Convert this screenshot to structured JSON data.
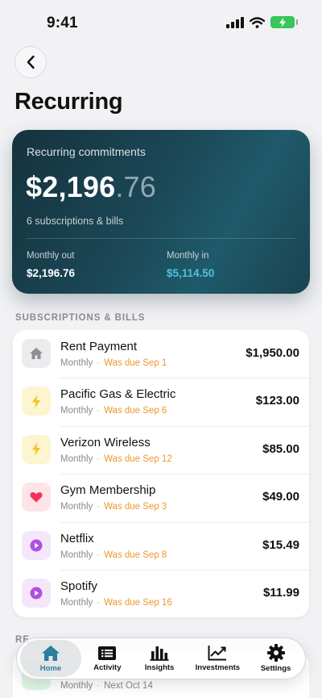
{
  "status": {
    "time": "9:41"
  },
  "page": {
    "title": "Recurring"
  },
  "summary": {
    "label": "Recurring commitments",
    "amount_main": "$2,196",
    "amount_cents": ".76",
    "subtitle": "6 subscriptions & bills",
    "monthly_out_label": "Monthly out",
    "monthly_out_value": "$2,196.76",
    "monthly_in_label": "Monthly in",
    "monthly_in_value": "$5,114.50"
  },
  "section": {
    "label": "SUBSCRIPTIONS & BILLS"
  },
  "items": [
    {
      "name": "Rent Payment",
      "frequency": "Monthly",
      "sep": "·",
      "due": "Was due Sep 1",
      "amount": "$1,950.00",
      "icon": "home-icon"
    },
    {
      "name": "Pacific Gas & Electric",
      "frequency": "Monthly",
      "sep": "·",
      "due": "Was due Sep 6",
      "amount": "$123.00",
      "icon": "bolt-icon"
    },
    {
      "name": "Verizon Wireless",
      "frequency": "Monthly",
      "sep": "·",
      "due": "Was due Sep 12",
      "amount": "$85.00",
      "icon": "bolt-icon"
    },
    {
      "name": "Gym Membership",
      "frequency": "Monthly",
      "sep": "·",
      "due": "Was due Sep 3",
      "amount": "$49.00",
      "icon": "heart-icon"
    },
    {
      "name": "Netflix",
      "frequency": "Monthly",
      "sep": "·",
      "due": "Was due Sep 8",
      "amount": "$15.49",
      "icon": "play-icon"
    },
    {
      "name": "Spotify",
      "frequency": "Monthly",
      "sep": "·",
      "due": "Was due Sep 16",
      "amount": "$11.99",
      "icon": "play-icon"
    }
  ],
  "section2": {
    "label": "RE"
  },
  "income_item": {
    "frequency": "Monthly",
    "sep": "·",
    "next": "Next Oct 14"
  },
  "tabs": [
    {
      "label": "Home",
      "icon": "home-icon"
    },
    {
      "label": "Activity",
      "icon": "receipt-icon"
    },
    {
      "label": "Insights",
      "icon": "bar-chart-icon"
    },
    {
      "label": "Investments",
      "icon": "trend-up-icon"
    },
    {
      "label": "Settings",
      "icon": "gear-icon"
    }
  ],
  "colors": {
    "accent": "#2a7f9c",
    "due_warning": "#f0952c",
    "income": "#4fc3dc",
    "battery": "#35c759"
  }
}
